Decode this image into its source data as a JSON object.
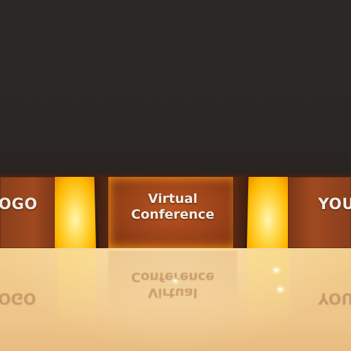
{
  "scene": {
    "left_panel_text": "LOGO",
    "center_panel_line1": "Virtual",
    "center_panel_line2": "Conference",
    "right_panel_text": "YOUR",
    "colors": {
      "backdrop": "#2b2725",
      "panel": "#9a4219",
      "glow": "#ffd84a",
      "floor": "#f0c98a"
    }
  }
}
